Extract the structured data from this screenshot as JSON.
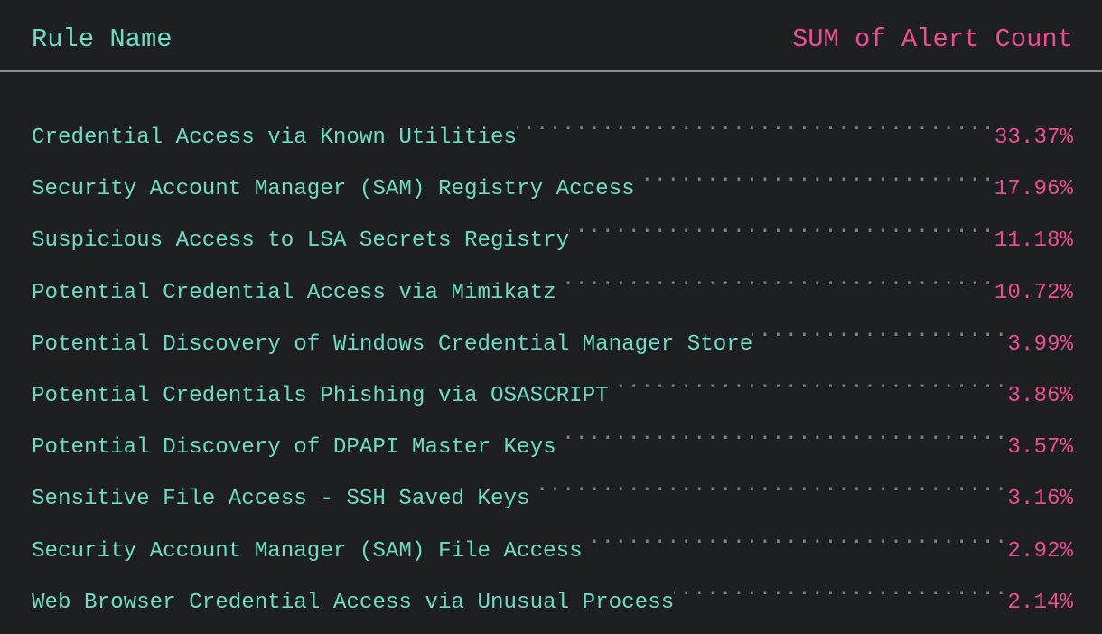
{
  "colors": {
    "background": "#1e1f23",
    "label": "#6fdcc1",
    "value": "#ea4f8e",
    "leader": "#7d7e88",
    "divider": "#8a8b95"
  },
  "header": {
    "name_column": "Rule Name",
    "value_column": "SUM of Alert Count"
  },
  "chart_data": {
    "type": "table",
    "title": "",
    "columns": [
      "Rule Name",
      "SUM of Alert Count"
    ],
    "value_unit": "percent",
    "rows": [
      {
        "label": "Credential Access via Known Utilities",
        "value": 33.37,
        "display": "33.37%"
      },
      {
        "label": "Security Account Manager (SAM) Registry Access",
        "value": 17.96,
        "display": "17.96%"
      },
      {
        "label": "Suspicious Access to LSA Secrets Registry",
        "value": 11.18,
        "display": "11.18%"
      },
      {
        "label": "Potential Credential Access via Mimikatz",
        "value": 10.72,
        "display": "10.72%"
      },
      {
        "label": "Potential Discovery of Windows Credential Manager Store",
        "value": 3.99,
        "display": "3.99%"
      },
      {
        "label": "Potential Credentials Phishing via OSASCRIPT",
        "value": 3.86,
        "display": "3.86%"
      },
      {
        "label": "Potential Discovery of DPAPI Master Keys",
        "value": 3.57,
        "display": "3.57%"
      },
      {
        "label": "Sensitive File Access - SSH Saved Keys",
        "value": 3.16,
        "display": "3.16%"
      },
      {
        "label": "Security Account Manager (SAM) File Access",
        "value": 2.92,
        "display": "2.92%"
      },
      {
        "label": "Web Browser Credential Access via Unusual Process",
        "value": 2.14,
        "display": "2.14%"
      }
    ]
  }
}
